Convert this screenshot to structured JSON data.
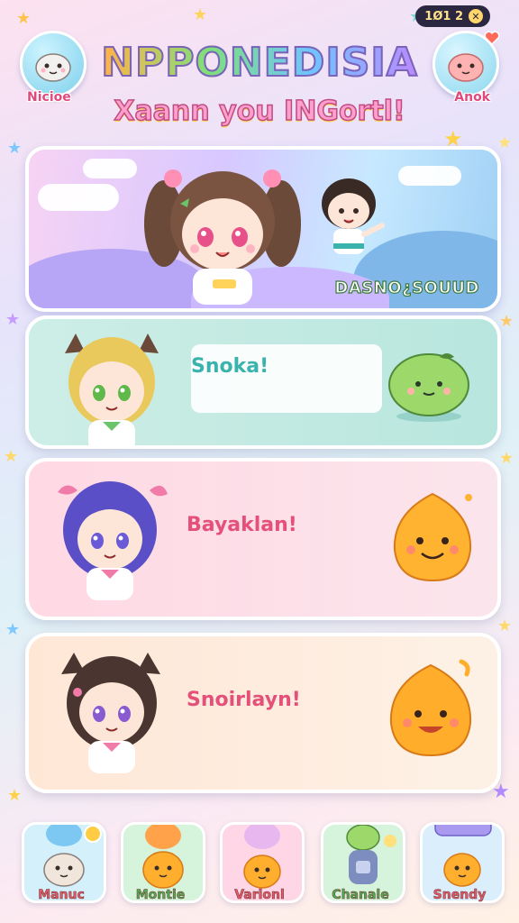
{
  "header": {
    "title": "NPPONEDISIA",
    "subtitle": "Xaann you INGortl!",
    "left_button_label": "Nicioe",
    "right_button_label": "Anok",
    "currency_value": "1Ø1 2"
  },
  "banner": {
    "text": "DASNO¿SOUUD"
  },
  "cards": [
    {
      "title": "Snoka!"
    },
    {
      "title": "Bayaklan!"
    },
    {
      "title": "Snoirlayn!"
    }
  ],
  "bottom_nav": [
    {
      "label": "Manuc"
    },
    {
      "label": "Montie"
    },
    {
      "label": "Varionl"
    },
    {
      "label": "Chanale"
    },
    {
      "label": "Snendy"
    }
  ],
  "colors": {
    "accent_pink": "#e5507a",
    "accent_teal": "#3ab3ad",
    "title_outline": "#7a63b8"
  }
}
